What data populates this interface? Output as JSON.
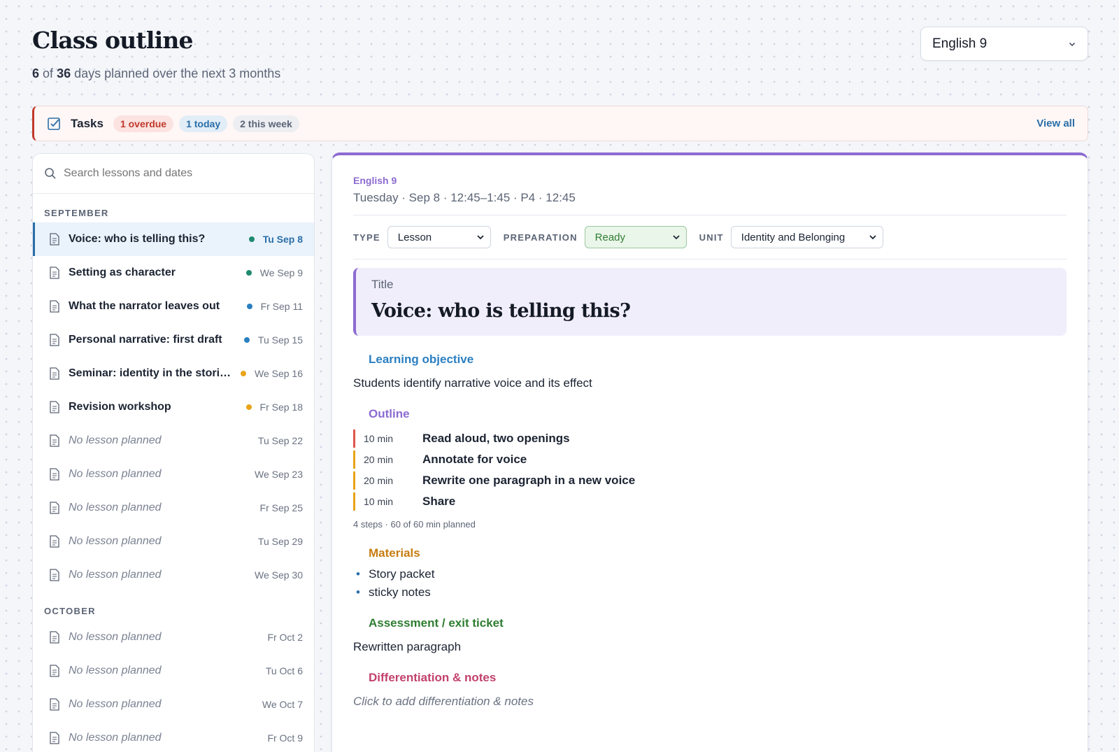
{
  "header": {
    "title": "Class outline",
    "planned_count": "6",
    "of_text": "of",
    "total_days": "36",
    "subtitle_rest": "days planned over the next 3 months",
    "course_selector": "English 9"
  },
  "tasks": {
    "label": "Tasks",
    "overdue": "1 overdue",
    "today": "1 today",
    "week": "2 this week",
    "view_all": "View all"
  },
  "sidebar": {
    "search_placeholder": "Search lessons and dates",
    "months": [
      {
        "label": "SEPTEMBER",
        "lessons": [
          {
            "title": "Voice: who is telling this?",
            "date": "Tu Sep 8",
            "dot": "#1f8a70",
            "selected": true
          },
          {
            "title": "Setting as character",
            "date": "We Sep 9",
            "dot": "#1f8a70"
          },
          {
            "title": "What the narrator leaves out",
            "date": "Fr Sep 11",
            "dot": "#2a7fc1"
          },
          {
            "title": "Personal narrative: first draft",
            "date": "Tu Sep 15",
            "dot": "#2a7fc1"
          },
          {
            "title": "Seminar: identity in the stories ...",
            "date": "We Sep 16",
            "dot": "#e8a317"
          },
          {
            "title": "Revision workshop",
            "date": "Fr Sep 18",
            "dot": "#e8a317"
          },
          {
            "title": "No lesson planned",
            "date": "Tu Sep 22",
            "empty": true
          },
          {
            "title": "No lesson planned",
            "date": "We Sep 23",
            "empty": true
          },
          {
            "title": "No lesson planned",
            "date": "Fr Sep 25",
            "empty": true
          },
          {
            "title": "No lesson planned",
            "date": "Tu Sep 29",
            "empty": true
          },
          {
            "title": "No lesson planned",
            "date": "We Sep 30",
            "empty": true
          }
        ]
      },
      {
        "label": "OCTOBER",
        "lessons": [
          {
            "title": "No lesson planned",
            "date": "Fr Oct 2",
            "empty": true
          },
          {
            "title": "No lesson planned",
            "date": "Tu Oct 6",
            "empty": true
          },
          {
            "title": "No lesson planned",
            "date": "We Oct 7",
            "empty": true
          },
          {
            "title": "No lesson planned",
            "date": "Fr Oct 9",
            "empty": true
          }
        ]
      }
    ]
  },
  "lesson": {
    "course": "English 9",
    "datetime": "Tuesday · Sep 8 · 12:45–1:45 · P4 · 12:45",
    "type_label": "TYPE",
    "type_value": "Lesson",
    "prep_label": "PREPARATION",
    "prep_value": "Ready",
    "unit_label": "UNIT",
    "unit_value": "Identity and Belonging",
    "title_label": "Title",
    "title": "Voice: who is telling this?",
    "objective_label": "Learning objective",
    "objective": "Students identify narrative voice and its effect",
    "outline_label": "Outline",
    "outline": [
      {
        "minutes": "10 min",
        "text": "Read aloud, two openings",
        "color": "#e0554a"
      },
      {
        "minutes": "20 min",
        "text": "Annotate for voice",
        "color": "#e8a317"
      },
      {
        "minutes": "20 min",
        "text": "Rewrite one paragraph in a new voice",
        "color": "#e8a317"
      },
      {
        "minutes": "10 min",
        "text": "Share",
        "color": "#e8a317"
      }
    ],
    "outline_summary": "4 steps · 60 of 60 min planned",
    "materials_label": "Materials",
    "materials": [
      "Story packet",
      "sticky notes"
    ],
    "assessment_label": "Assessment / exit ticket",
    "assessment": "Rewritten paragraph",
    "notes_label": "Differentiation & notes",
    "notes_placeholder": "Click to add differentiation & notes"
  },
  "colors": {
    "objective": "#2a7fc1",
    "outline": "#8c6bd1",
    "materials": "#c77d12",
    "assessment": "#2f7d32",
    "notes": "#c2416b"
  }
}
